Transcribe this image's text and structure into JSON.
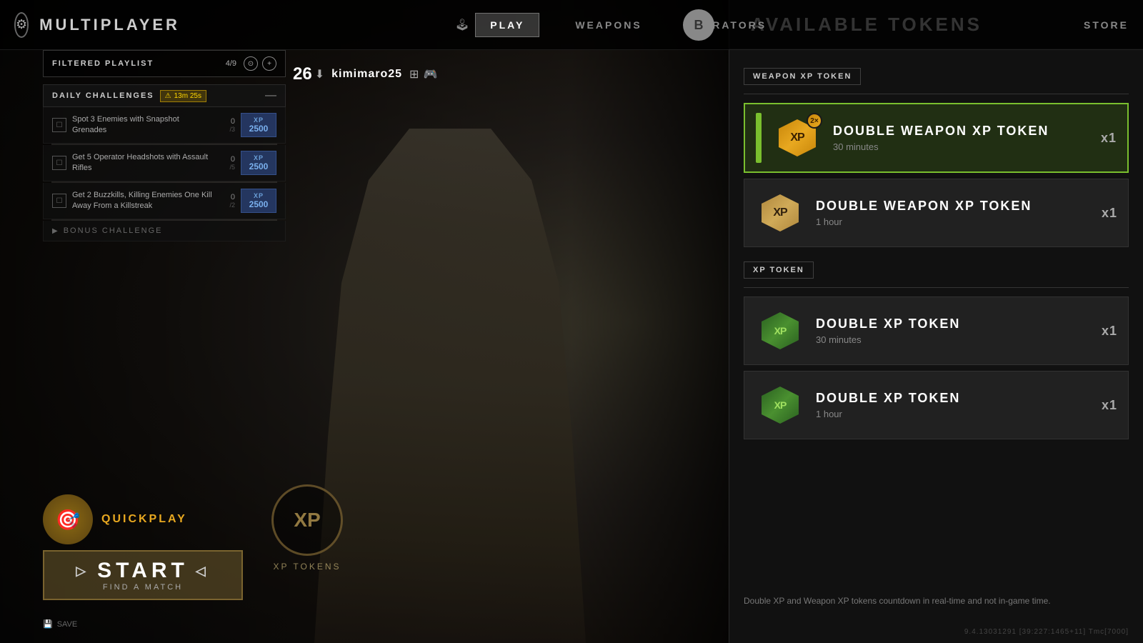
{
  "header": {
    "title": "MULTIPLAYER",
    "nav_items": [
      {
        "label": "PLAY",
        "active": true
      },
      {
        "label": "WEAPONS",
        "active": false
      },
      {
        "label": "OPERATORS",
        "active": false
      }
    ],
    "store_label": "STORE",
    "b_button_label": "B",
    "controller_icon": "🎮"
  },
  "sidebar": {
    "playlist": {
      "label": "FILTERED PLAYLIST",
      "count": "4/9"
    },
    "challenges": {
      "label": "DAILY CHALLENGES",
      "timer": "13m 25s",
      "items": [
        {
          "text": "Spot 3 Enemies with Snapshot Grenades",
          "progress": "0",
          "total": "/3",
          "xp": "2500"
        },
        {
          "text": "Get 5 Operator Headshots with Assault Rifles",
          "progress": "0",
          "total": "/5",
          "xp": "2500"
        },
        {
          "text": "Get 2 Buzzkills, Killing Enemies One Kill Away From a Killstreak",
          "progress": "0",
          "total": "/2",
          "xp": "2500"
        }
      ],
      "bonus_label": "BONUS CHALLENGE"
    }
  },
  "player": {
    "level": "26",
    "name": "kimimaro25",
    "platform1": "Xbox",
    "platform2": "Controller"
  },
  "xp_tokens_center": {
    "label": "XP TOKENS",
    "icon_text": "XP"
  },
  "bottom": {
    "quickplay_label": "QUICKPLAY",
    "start_label": "START",
    "start_sub": "FIND A MATCH",
    "save_label": "SAVE"
  },
  "tokens_panel": {
    "title": "AVAILABLE TOKENS",
    "weapon_xp_section": {
      "label": "WEAPON XP TOKEN",
      "items": [
        {
          "name": "DOUBLE WEAPON XP TOKEN",
          "duration": "30 minutes",
          "count": "x1",
          "active": true
        },
        {
          "name": "DOUBLE WEAPON XP TOKEN",
          "duration": "1 hour",
          "count": "x1",
          "active": false
        }
      ]
    },
    "xp_section": {
      "label": "XP TOKEN",
      "items": [
        {
          "name": "DOUBLE XP TOKEN",
          "duration": "30 minutes",
          "count": "x1",
          "active": false
        },
        {
          "name": "DOUBLE XP TOKEN",
          "duration": "1 hour",
          "count": "x1",
          "active": false
        }
      ]
    },
    "footer_note": "Double XP and Weapon XP tokens countdown in real-time and not in-game time.",
    "version": "9.4.13031291 [39:227:1465+11] Tmc[7000]"
  }
}
